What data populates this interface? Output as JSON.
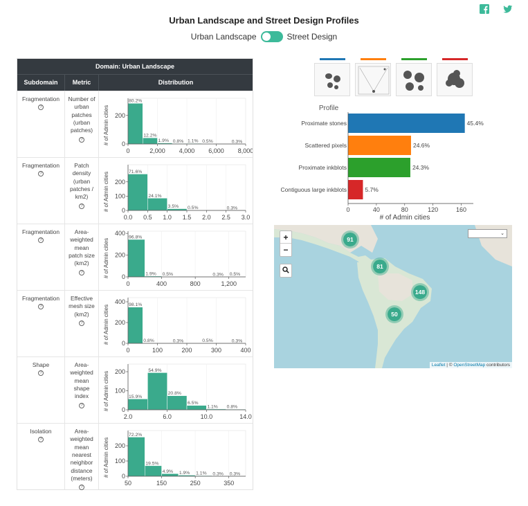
{
  "title": "Urban Landscape and Street Design Profiles",
  "toggle": {
    "left_label": "Urban Landscape",
    "right_label": "Street Design"
  },
  "social": [
    {
      "icon": "facebook-icon"
    },
    {
      "icon": "twitter-icon"
    }
  ],
  "colors": {
    "accent": "#3dba9a",
    "header_bg": "#343a40",
    "bar": "#3aaa8c"
  },
  "table": {
    "domain_label": "Domain: Urban Landscape",
    "columns": [
      "Subdomain",
      "Metric",
      "Distribution"
    ],
    "y_axis_label": "# of Admin cities",
    "rows": [
      {
        "subdomain": "Fragmentation",
        "metric": [
          "Number of",
          "urban",
          "patches",
          "(urban",
          "patches)"
        ],
        "chart_data": {
          "type": "bar",
          "ylim": [
            0,
            320
          ],
          "yticks": [
            "0",
            "200"
          ],
          "xticks": [
            "0",
            "2,000",
            "4,000",
            "6,000",
            "8,000"
          ],
          "xtick_bins": [
            0,
            2,
            4,
            6,
            8
          ],
          "bins": 8,
          "counts": [
            285,
            43,
            7,
            3,
            4,
            2,
            0,
            1
          ],
          "labels": [
            "80.2%",
            "12.2%",
            "1.9%",
            "0.8%",
            "1.1%",
            "0.5%",
            "",
            "0.3%"
          ]
        }
      },
      {
        "subdomain": "Fragmentation",
        "metric": [
          "Patch",
          "density",
          "(urban",
          "patches /",
          "km2)"
        ],
        "chart_data": {
          "type": "bar",
          "ylim": [
            0,
            320
          ],
          "yticks": [
            "0",
            "100",
            "200"
          ],
          "xticks": [
            "0.0",
            "0.5",
            "1.0",
            "1.5",
            "2.0",
            "2.5",
            "3.0"
          ],
          "xtick_bins": [
            0,
            1,
            2,
            3,
            4,
            5,
            6
          ],
          "bins": 6,
          "counts": [
            255,
            86,
            12,
            2,
            0,
            1
          ],
          "labels": [
            "71.6%",
            "24.1%",
            "3.5%",
            "0.5%",
            "",
            "0.3%"
          ]
        }
      },
      {
        "subdomain": "Fragmentation",
        "metric": [
          "Area-",
          "weighted",
          "mean",
          "patch size",
          "(km2)"
        ],
        "chart_data": {
          "type": "bar",
          "ylim": [
            0,
            420
          ],
          "yticks": [
            "0",
            "200",
            "400"
          ],
          "xticks": [
            "0",
            "400",
            "800",
            "1,200"
          ],
          "xtick_bins": [
            0,
            2,
            4,
            6
          ],
          "bins": 7,
          "counts": [
            344,
            7,
            2,
            0,
            0,
            1,
            2
          ],
          "labels": [
            "96.8%",
            "1.9%",
            "0.5%",
            "",
            "",
            "0.3%",
            "0.5%"
          ]
        }
      },
      {
        "subdomain": "Fragmentation",
        "metric": [
          "Effective",
          "mesh size",
          "(km2)"
        ],
        "chart_data": {
          "type": "bar",
          "ylim": [
            0,
            440
          ],
          "yticks": [
            "0",
            "200",
            "400"
          ],
          "xticks": [
            "0",
            "100",
            "200",
            "300",
            "400"
          ],
          "xtick_bins": [
            0,
            2,
            4,
            6,
            8
          ],
          "bins": 8,
          "counts": [
            349,
            3,
            0,
            1,
            0,
            2,
            0,
            1
          ],
          "labels": [
            "98.1%",
            "0.8%",
            "",
            "0.3%",
            "",
            "0.5%",
            "",
            "0.3%"
          ]
        }
      },
      {
        "subdomain": "Shape",
        "metric": [
          "Area-",
          "weighted",
          "mean",
          "shape",
          "index"
        ],
        "chart_data": {
          "type": "bar",
          "ylim": [
            0,
            240
          ],
          "yticks": [
            "0",
            "100",
            "200"
          ],
          "xticks": [
            "2.0",
            "6.0",
            "10.0",
            "14.0"
          ],
          "xtick_bins": [
            0,
            2,
            4,
            6
          ],
          "bins": 6,
          "counts": [
            57,
            195,
            74,
            23,
            4,
            3
          ],
          "labels": [
            "15.9%",
            "54.9%",
            "20.8%",
            "6.5%",
            "1.1%",
            "0.8%"
          ]
        }
      },
      {
        "subdomain": "Isolation",
        "metric": [
          "Area-",
          "weighted",
          "mean",
          "nearest",
          "neighbor",
          "distance",
          "(meters)"
        ],
        "chart_data": {
          "type": "bar",
          "ylim": [
            0,
            300
          ],
          "yticks": [
            "0",
            "100",
            "200"
          ],
          "xticks": [
            "50",
            "150",
            "250",
            "350"
          ],
          "xtick_bins": [
            0,
            2,
            4,
            6
          ],
          "bins": 7,
          "counts": [
            257,
            69,
            17,
            7,
            4,
            1,
            1
          ],
          "labels": [
            "72.2%",
            "19.5%",
            "4.9%",
            "1.9%",
            "1.1%",
            "0.3%",
            "0.3%"
          ]
        }
      }
    ]
  },
  "profile": {
    "header": "Profile",
    "thumbnail_colors": [
      "#1f77b4",
      "#ff7f0e",
      "#2ca02c",
      "#d62728"
    ],
    "chart_data": {
      "type": "bar",
      "orientation": "horizontal",
      "categories": [
        "Proximate stones",
        "Scattered pixels",
        "Proximate inkblots",
        "Contiguous large inkblots"
      ],
      "values": [
        165,
        89,
        88,
        21
      ],
      "labels": [
        "45.4%",
        "24.6%",
        "24.3%",
        "5.7%"
      ],
      "colors": [
        "#1f77b4",
        "#ff7f0e",
        "#2ca02c",
        "#d62728"
      ],
      "xlim": [
        0,
        180
      ],
      "xticks": [
        "0",
        "40",
        "80",
        "120",
        "160"
      ],
      "xlabel": "# of Admin cities"
    }
  },
  "map": {
    "zoom_in": "+",
    "zoom_out": "−",
    "clusters": [
      {
        "count": "91"
      },
      {
        "count": "81"
      },
      {
        "count": "148"
      },
      {
        "count": "50"
      }
    ],
    "attribution_leaflet": "Leaflet",
    "attribution_sep": " | © ",
    "attribution_osm": "OpenStreetMap",
    "attribution_rest": " contributors"
  }
}
